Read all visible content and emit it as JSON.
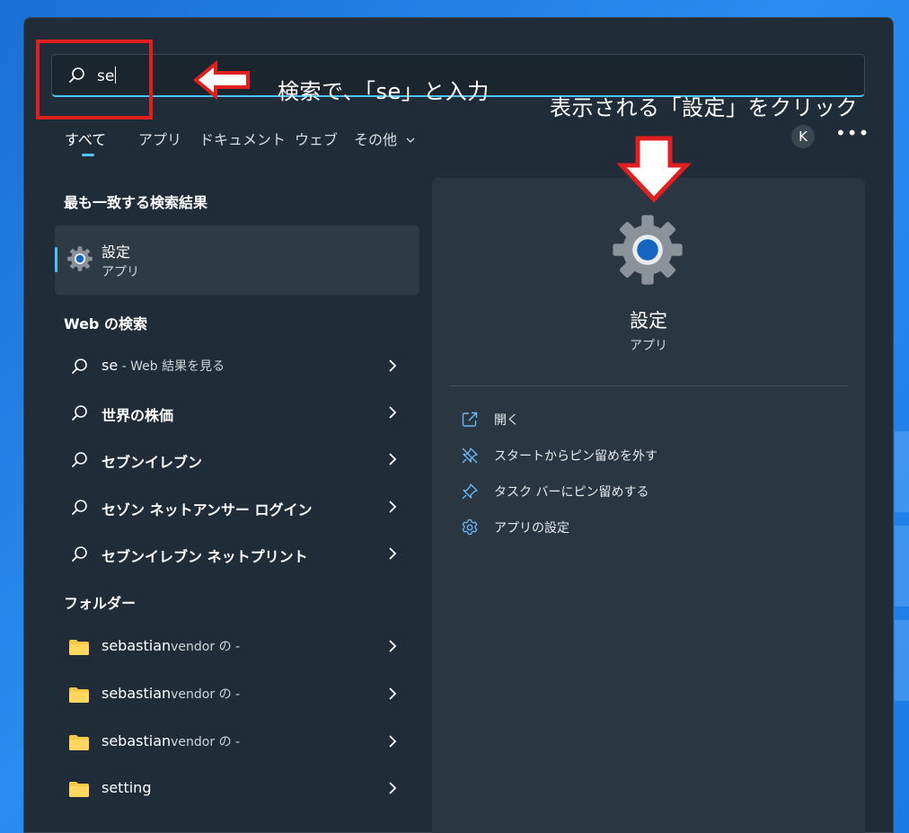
{
  "search": {
    "query": "se"
  },
  "annotations": {
    "step1": "検索で、「se」と入力",
    "step2": "表示される「設定」をクリック"
  },
  "tabs": [
    {
      "label": "すべて",
      "active": true
    },
    {
      "label": "アプリ"
    },
    {
      "label": "ドキュメント"
    },
    {
      "label": "ウェブ"
    },
    {
      "label": "その他"
    }
  ],
  "account_initial": "K",
  "more_label": "•••",
  "best_match": {
    "heading": "最も一致する検索結果",
    "title": "設定",
    "subtitle": "アプリ"
  },
  "web_search": {
    "heading": "Web の検索",
    "items": [
      {
        "query": "se",
        "suffix": " - Web 結果を見る"
      },
      {
        "query": "世界の株価"
      },
      {
        "query": "セブンイレブン"
      },
      {
        "query": "セゾン ネットアンサー ログイン"
      },
      {
        "query": "セブンイレブン ネットプリント"
      }
    ]
  },
  "folders": {
    "heading": "フォルダー",
    "items": [
      {
        "name": "sebastian",
        "suffix": "vendor の -"
      },
      {
        "name": "sebastian",
        "suffix": "vendor の -"
      },
      {
        "name": "sebastian",
        "suffix": "vendor の -"
      },
      {
        "name": "setting",
        "suffix": ""
      }
    ]
  },
  "preview": {
    "title": "設定",
    "subtitle": "アプリ",
    "actions": [
      {
        "label": "開く",
        "icon": "open-external-icon"
      },
      {
        "label": "スタートからピン留めを外す",
        "icon": "unpin-icon"
      },
      {
        "label": "タスク バーにピン留めする",
        "icon": "pin-icon"
      },
      {
        "label": "アプリの設定",
        "icon": "gear-icon"
      }
    ]
  },
  "colors": {
    "accent": "#4cc2ff",
    "annotation_red": "#e02020",
    "panel_bg": "#202d38",
    "folder_yellow": "#f7c948"
  }
}
